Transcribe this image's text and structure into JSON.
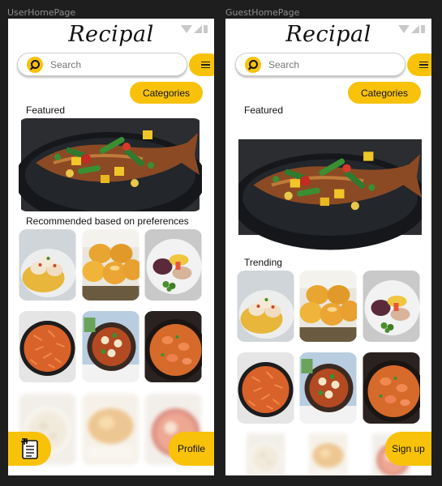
{
  "frames": {
    "user": {
      "label": "UserHomePage",
      "logo": "Recipal",
      "search": {
        "placeholder": "Search"
      },
      "categories_label": "Categories",
      "featured_label": "Featured",
      "recommended_label": "Recommended based on preferences",
      "profile_label": "Profile"
    },
    "guest": {
      "label": "GuestHomePage",
      "logo": "Recipal",
      "search": {
        "placeholder": "Search"
      },
      "categories_label": "Categories",
      "featured_label": "Featured",
      "trending_label": "Trending",
      "signup_label": "Sign up"
    }
  },
  "icons": {
    "search": "search-icon",
    "menu": "hamburger-menu-icon",
    "notes": "recipe-notes-icon",
    "wifi": "wifi-icon",
    "signal": "signal-icon",
    "battery": "battery-icon"
  },
  "colors": {
    "accent": "#f8c20b",
    "background": "#1e1e1e",
    "frame_label": "#8d8d8d"
  }
}
